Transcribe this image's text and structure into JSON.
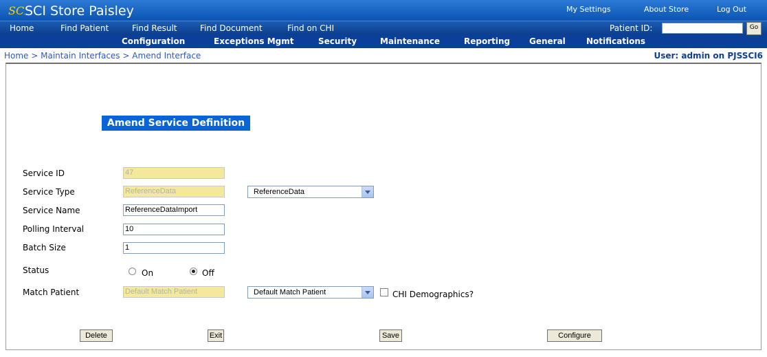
{
  "header": {
    "app_title": "SCI Store Paisley",
    "logo_text": "SCI",
    "my_settings": "My Settings",
    "about_store": "About Store",
    "log_out": "Log Out"
  },
  "nav_primary": {
    "home": "Home",
    "find_patient": "Find Patient",
    "find_result": "Find Result",
    "find_document": "Find Document",
    "find_on_chi": "Find on CHI",
    "patient_id_label": "Patient ID:",
    "patient_id_value": "",
    "go_label": "Go"
  },
  "nav_secondary": {
    "configuration": "Configuration",
    "exceptions_mgmt": "Exceptions Mgmt",
    "security": "Security",
    "maintenance": "Maintenance",
    "reporting": "Reporting",
    "general": "General",
    "notifications": "Notifications"
  },
  "breadcrumb": {
    "home": "Home",
    "sep1": " > ",
    "maintain_interfaces": "Maintain Interfaces",
    "sep2": " > ",
    "current": "Amend Interface"
  },
  "user_info": "User: admin on PJSSCI6",
  "form": {
    "heading": "Amend Service Definition",
    "service_id_label": "Service ID",
    "service_id_value": "47",
    "service_type_label": "Service Type",
    "service_type_value": "ReferenceData",
    "service_type_select": "ReferenceData",
    "service_name_label": "Service Name",
    "service_name_value": "ReferenceDataImport",
    "polling_interval_label": "Polling Interval",
    "polling_interval_value": "10",
    "batch_size_label": "Batch Size",
    "batch_size_value": "1",
    "status_label": "Status",
    "status_on": "On",
    "status_off": "Off",
    "status_selected": "Off",
    "match_patient_label": "Match Patient",
    "match_patient_value": "Default Match Patient",
    "match_patient_select": "Default Match Patient",
    "chi_demographics_label": "CHI Demographics?",
    "chi_demographics_checked": false
  },
  "buttons": {
    "delete": "Delete",
    "exit": "Exit",
    "save": "Save",
    "configure": "Configure"
  }
}
